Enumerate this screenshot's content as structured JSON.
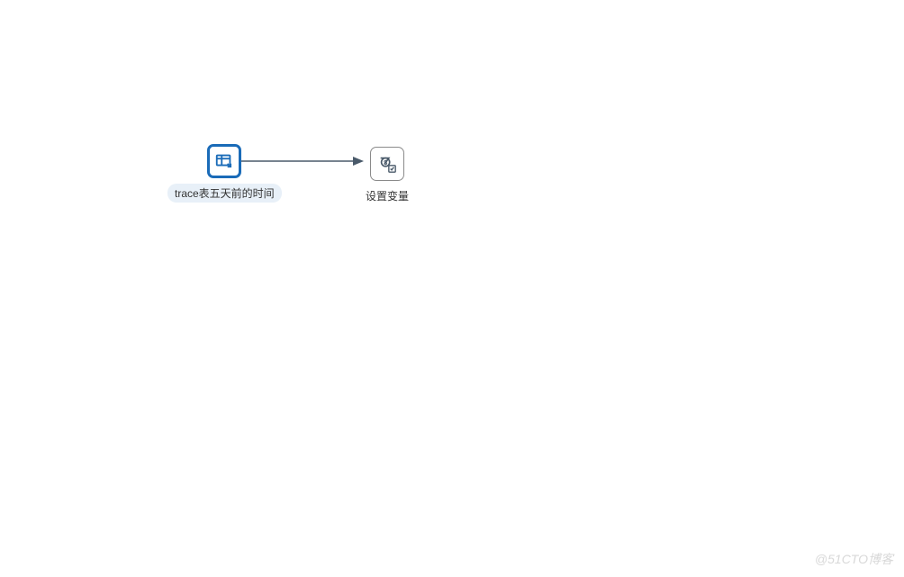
{
  "nodes": {
    "source": {
      "label": "trace表五天前的时间",
      "type": "table-input",
      "selected": true
    },
    "target": {
      "label": "设置变量",
      "type": "set-variable",
      "selected": false
    }
  },
  "watermark": "@51CTO博客"
}
